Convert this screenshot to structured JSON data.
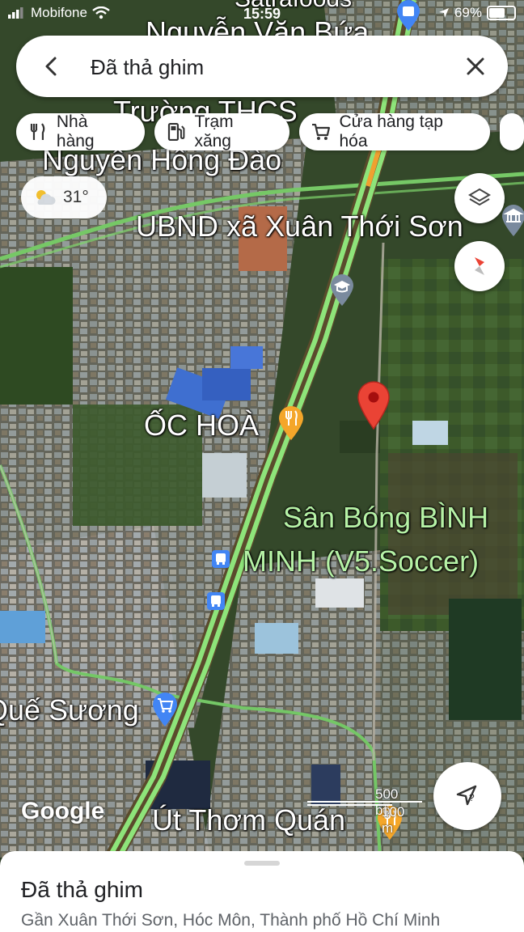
{
  "status_bar": {
    "carrier": "Mobifone",
    "time": "15:59",
    "battery_text": "69%",
    "battery_level": 0.69
  },
  "search": {
    "query": "Đã thả ghim"
  },
  "chips": [
    {
      "label": "Nhà hàng",
      "icon": "fork-knife-icon"
    },
    {
      "label": "Trạm xăng",
      "icon": "gas-pump-icon"
    },
    {
      "label": "Cửa hàng tạp hóa",
      "icon": "cart-icon"
    }
  ],
  "weather": {
    "temperature": "31°",
    "icon": "partly-cloudy-icon"
  },
  "map": {
    "labels": {
      "street_top": "Nguyễn Văn Bứa",
      "poi_top": "Satrafoods",
      "school_1": "Trường THCS",
      "school_2": "Nguyễn Hồng Đào",
      "ubnd": "UBND xã Xuân Thới Sơn",
      "restaurant": "ỐC HOÀ",
      "stadium_1": "Sân Bóng BÌNH",
      "stadium_2": "MINH (V5.Soccer)",
      "market": "Quế Sương",
      "cafe": "Út Thơm Quán"
    },
    "scale": {
      "imperial": "500 bộ",
      "metric": "100 m"
    },
    "attribution": "Google",
    "colors": {
      "route": "#8fe07a",
      "pin": "#ea4335",
      "food_poi": "#f4a62a",
      "shop_poi": "#4285f4"
    }
  },
  "place_sheet": {
    "title": "Đã thả ghim",
    "address": "Gần Xuân Thới Sơn, Hóc Môn, Thành phố Hồ Chí Minh"
  }
}
